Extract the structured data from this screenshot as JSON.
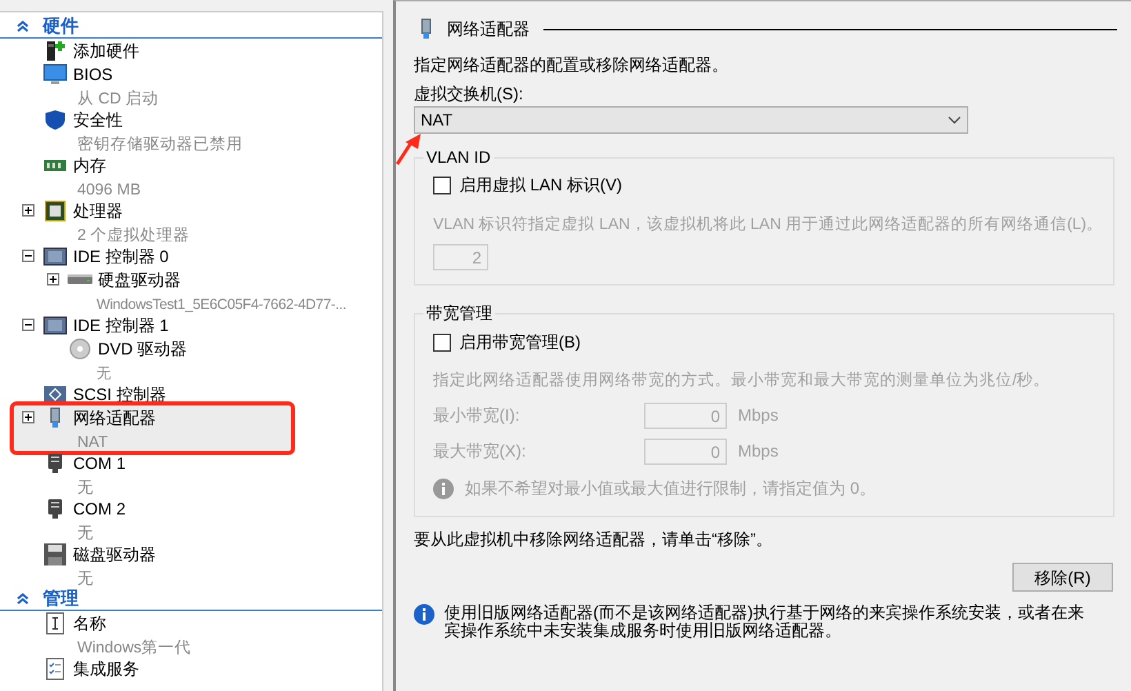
{
  "sidebar": {
    "sections": [
      {
        "title": "硬件",
        "expanded": true,
        "items": [
          {
            "kind": "add-hardware",
            "label": "添加硬件",
            "selected": false,
            "highlighted": false
          },
          {
            "kind": "bios",
            "label": "BIOS",
            "detail": "从 CD 启动",
            "selected": false,
            "highlighted": false
          },
          {
            "kind": "security",
            "label": "安全性",
            "detail": "密钥存储驱动器已禁用",
            "selected": false,
            "highlighted": false
          },
          {
            "kind": "memory",
            "label": "内存",
            "detail": "4096 MB",
            "selected": false,
            "highlighted": false
          },
          {
            "kind": "processor",
            "label": "处理器",
            "detail": "2 个虚拟处理器",
            "expanded": false,
            "selected": false,
            "highlighted": false
          },
          {
            "kind": "controller",
            "label": "IDE 控制器 0",
            "expanded": true,
            "selected": false,
            "highlighted": false,
            "children": [
              {
                "kind": "hard-disk",
                "label": "硬盘驱动器",
                "detail": "WindowsTest1_5E6C05F4-7662-4D77-...",
                "expanded": false,
                "selected": false,
                "highlighted": false
              }
            ]
          },
          {
            "kind": "controller",
            "label": "IDE 控制器 1",
            "expanded": true,
            "selected": false,
            "highlighted": false,
            "children": [
              {
                "kind": "dvd",
                "label": "DVD 驱动器",
                "detail": "无",
                "selected": false,
                "highlighted": false
              }
            ]
          },
          {
            "kind": "scsi",
            "label": "SCSI 控制器",
            "selected": false,
            "highlighted": false
          },
          {
            "kind": "network",
            "label": "网络适配器",
            "detail": "NAT",
            "expanded": false,
            "selected": true,
            "highlighted": true
          },
          {
            "kind": "com",
            "label": "COM 1",
            "detail": "无",
            "selected": false,
            "highlighted": false
          },
          {
            "kind": "com",
            "label": "COM 2",
            "detail": "无",
            "selected": false,
            "highlighted": false
          },
          {
            "kind": "floppy",
            "label": "磁盘驱动器",
            "detail": "无",
            "selected": false,
            "highlighted": false
          }
        ]
      },
      {
        "title": "管理",
        "expanded": true,
        "items": [
          {
            "kind": "name",
            "label": "名称",
            "detail": "Windows第一代",
            "selected": false,
            "highlighted": false
          },
          {
            "kind": "services",
            "label": "集成服务",
            "selected": false,
            "highlighted": false
          }
        ]
      }
    ]
  },
  "panel": {
    "title": "网络适配器",
    "description": "指定网络适配器的配置或移除网络适配器。",
    "switch": {
      "label": "虚拟交换机(S):",
      "value": "NAT",
      "marked": true
    },
    "vlan": {
      "legend": "VLAN ID",
      "checkbox": {
        "label": "启用虚拟 LAN 标识(V)",
        "checked": false
      },
      "description": "VLAN 标识符指定虚拟 LAN，该虚拟机将此 LAN 用于通过此网络适配器的所有网络通信(L)。",
      "value": "2",
      "disabled": true
    },
    "bandwidth": {
      "legend": "带宽管理",
      "checkbox": {
        "label": "启用带宽管理(B)",
        "checked": false
      },
      "description": "指定此网络适配器使用网络带宽的方式。最小带宽和最大带宽的测量单位为兆位/秒。",
      "disabled": true,
      "fields": [
        {
          "label": "最小带宽(I):",
          "value": "0",
          "unit": "Mbps"
        },
        {
          "label": "最大带宽(X):",
          "value": "0",
          "unit": "Mbps"
        }
      ],
      "note": "如果不希望对最小值或最大值进行限制，请指定值为 0。"
    },
    "remove_text": "要从此虚拟机中移除网络适配器，请单击“移除”。",
    "remove_button": "移除(R)",
    "info": "使用旧版网络适配器(而不是该网络适配器)执行基于网络的来宾操作系统安装，或者在来宾操作系统中未安装集成服务时使用旧版网络适配器。"
  }
}
